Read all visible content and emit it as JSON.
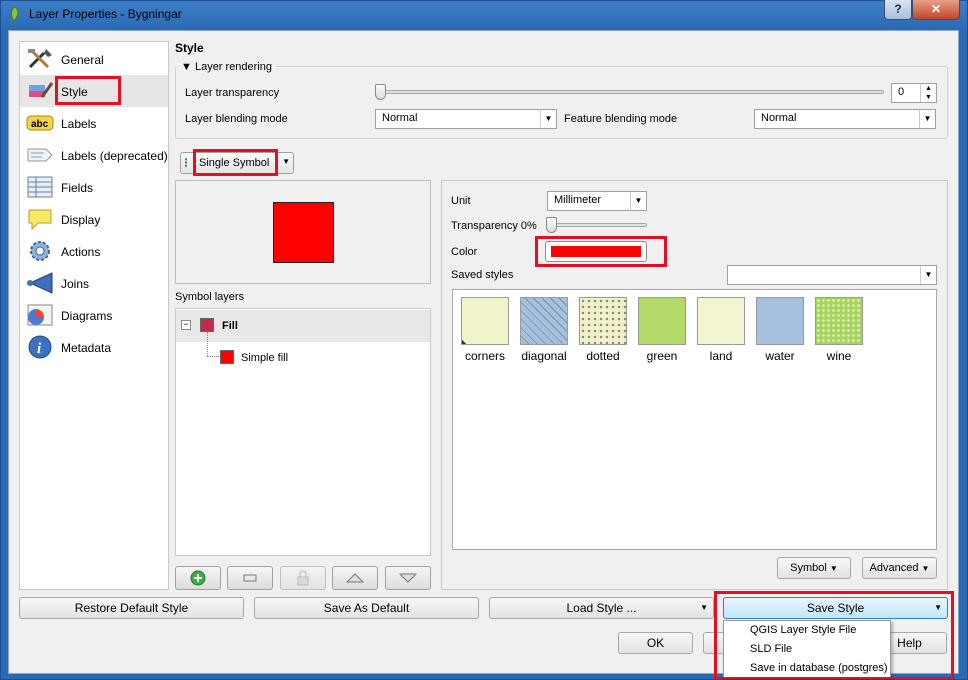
{
  "window": {
    "title": "Layer Properties - Bygningar",
    "help_btn": "?",
    "close_btn": "✕"
  },
  "nav": [
    {
      "label": "General",
      "icon": "tools-icon"
    },
    {
      "label": "Style",
      "icon": "paint-icon"
    },
    {
      "label": "Labels",
      "icon": "abc-label-icon"
    },
    {
      "label": "Labels (deprecated)",
      "icon": "label-tag-icon"
    },
    {
      "label": "Fields",
      "icon": "table-icon"
    },
    {
      "label": "Display",
      "icon": "speech-bubble-icon"
    },
    {
      "label": "Actions",
      "icon": "gear-actions-icon"
    },
    {
      "label": "Joins",
      "icon": "join-arrow-icon"
    },
    {
      "label": "Diagrams",
      "icon": "chart-icon"
    },
    {
      "label": "Metadata",
      "icon": "info-icon"
    }
  ],
  "style": {
    "heading": "Style",
    "layer_rendering": "Layer rendering",
    "transparency_label": "Layer transparency",
    "transparency_value": "0",
    "blending_label": "Layer blending mode",
    "blending_value": "Normal",
    "feature_blending_label": "Feature blending mode",
    "feature_blending_value": "Normal",
    "renderer": "Single Symbol",
    "symbol_layers_label": "Symbol layers",
    "tree_fill": "Fill",
    "tree_simple_fill": "Simple fill",
    "unit_label": "Unit",
    "unit_value": "Millimeter",
    "symbol_transparency_label": "Transparency 0%",
    "color_label": "Color",
    "color_value": "#ff0000",
    "saved_styles_label": "Saved styles",
    "saved_styles_value": "",
    "styles": [
      {
        "name": "corners",
        "color": "#f1f4cb"
      },
      {
        "name": "diagonal",
        "color": "#a8c0dc"
      },
      {
        "name": "dotted",
        "color": "#f3f0cc"
      },
      {
        "name": "green",
        "color": "#b3da68"
      },
      {
        "name": "land",
        "color": "#f3f4d0"
      },
      {
        "name": "water",
        "color": "#a6c0df"
      },
      {
        "name": "wine",
        "color": "#a6d45d"
      }
    ],
    "symbol_btn": "Symbol",
    "advanced_btn": "Advanced"
  },
  "footer": {
    "restore": "Restore Default Style",
    "save_default": "Save As Default",
    "load_style": "Load Style ...",
    "save_style": "Save Style",
    "ok": "OK",
    "help": "Help"
  },
  "save_menu": [
    "QGIS Layer Style File",
    "SLD File",
    "Save in database (postgres)"
  ]
}
